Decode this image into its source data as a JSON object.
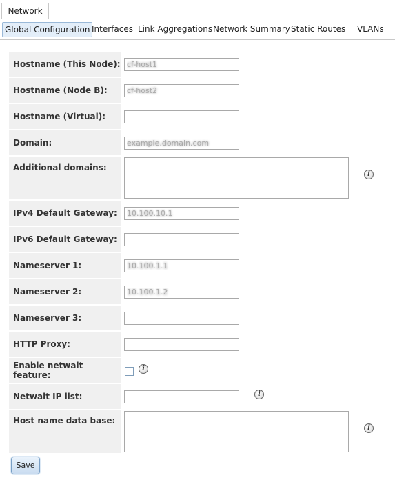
{
  "tabs": {
    "top": "Network",
    "sub": [
      "Global Configuration",
      "Interfaces",
      "Link Aggregations",
      "Network Summary",
      "Static Routes",
      "VLANs"
    ]
  },
  "form": {
    "hostname_this": {
      "label": "Hostname (This Node):",
      "value": "cf-host1"
    },
    "hostname_b": {
      "label": "Hostname (Node B):",
      "value": "cf-host2"
    },
    "hostname_virtual": {
      "label": "Hostname (Virtual):",
      "value": ""
    },
    "domain": {
      "label": "Domain:",
      "value": "example.domain.com"
    },
    "additional_domains": {
      "label": "Additional domains:",
      "value": ""
    },
    "ipv4_gateway": {
      "label": "IPv4 Default Gateway:",
      "value": "10.100.10.1"
    },
    "ipv6_gateway": {
      "label": "IPv6 Default Gateway:",
      "value": ""
    },
    "nameserver1": {
      "label": "Nameserver 1:",
      "value": "10.100.1.1"
    },
    "nameserver2": {
      "label": "Nameserver 2:",
      "value": "10.100.1.2"
    },
    "nameserver3": {
      "label": "Nameserver 3:",
      "value": ""
    },
    "http_proxy": {
      "label": "HTTP Proxy:",
      "value": ""
    },
    "netwait_feature": {
      "label": "Enable netwait feature:",
      "checked": false
    },
    "netwait_ip_list": {
      "label": "Netwait IP list:",
      "value": ""
    },
    "host_name_db": {
      "label": "Host name data base:",
      "value": ""
    }
  },
  "info_glyph": "i",
  "save_label": "Save"
}
